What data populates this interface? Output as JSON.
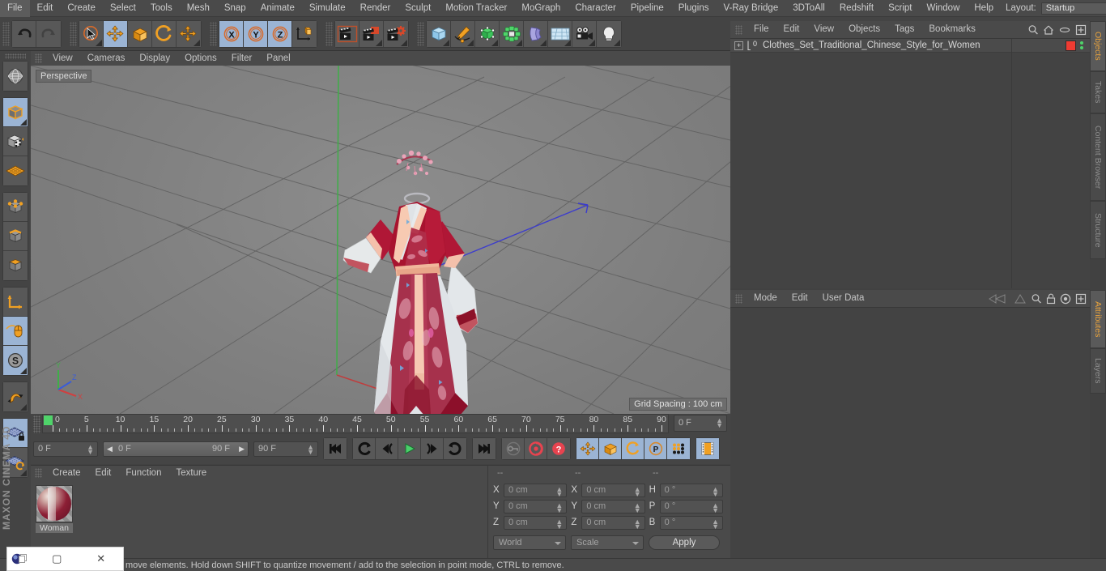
{
  "menubar": {
    "items": [
      "File",
      "Edit",
      "Create",
      "Select",
      "Tools",
      "Mesh",
      "Snap",
      "Animate",
      "Simulate",
      "Render",
      "Sculpt",
      "Motion Tracker",
      "MoGraph",
      "Character",
      "Pipeline",
      "Plugins",
      "V-Ray Bridge",
      "3DToAll",
      "Redshift",
      "Script",
      "Window",
      "Help"
    ],
    "layout_label": "Layout:",
    "layout_value": "Startup"
  },
  "toolbar": {
    "groups": [
      {
        "name": "undo-redo",
        "buttons": [
          {
            "icon": "undo-icon",
            "label": "Undo",
            "active": false
          },
          {
            "icon": "redo-icon",
            "label": "Redo",
            "active": false
          }
        ]
      },
      {
        "name": "transform-tools",
        "buttons": [
          {
            "icon": "live-selection-icon",
            "label": "Live Selection",
            "active": false
          },
          {
            "icon": "move-icon",
            "label": "Move",
            "active": true
          },
          {
            "icon": "scale-icon",
            "label": "Scale",
            "active": false
          },
          {
            "icon": "rotate-icon",
            "label": "Rotate",
            "active": false
          },
          {
            "icon": "move-dup-icon",
            "label": "Move",
            "active": false
          }
        ]
      },
      {
        "name": "axis-locks",
        "buttons": [
          {
            "icon": "x-axis-icon",
            "label": "X",
            "active": true
          },
          {
            "icon": "y-axis-icon",
            "label": "Y",
            "active": true
          },
          {
            "icon": "z-axis-icon",
            "label": "Z",
            "active": true
          },
          {
            "icon": "world-object-axis-icon",
            "label": "World/Object",
            "active": false
          }
        ]
      },
      {
        "name": "render-tools",
        "buttons": [
          {
            "icon": "render-view-icon",
            "label": "Render View",
            "active": false
          },
          {
            "icon": "render-region-icon",
            "label": "Render to Picture Viewer",
            "active": false
          },
          {
            "icon": "render-settings-icon",
            "label": "Edit Render Settings",
            "active": false
          }
        ]
      },
      {
        "name": "create-objects",
        "buttons": [
          {
            "icon": "cube-primitive-icon",
            "label": "Cube",
            "active": false
          },
          {
            "icon": "spline-pen-icon",
            "label": "Pen",
            "active": false
          },
          {
            "icon": "subdivision-surface-icon",
            "label": "Subdivision Surface",
            "active": false
          },
          {
            "icon": "mograph-cloner-icon",
            "label": "Cloner",
            "active": false
          },
          {
            "icon": "bend-deformer-icon",
            "label": "Bend",
            "active": false
          },
          {
            "icon": "floor-environment-icon",
            "label": "Floor",
            "active": false
          },
          {
            "icon": "camera-icon",
            "label": "Camera",
            "active": false
          },
          {
            "icon": "light-icon",
            "label": "Light",
            "active": false
          }
        ]
      }
    ]
  },
  "leftbar": {
    "groups": [
      {
        "name": "grp-a",
        "buttons": [
          {
            "icon": "texture-axis-icon",
            "label": "Texture Axis",
            "active": false
          }
        ]
      },
      {
        "name": "grp-modes",
        "buttons": [
          {
            "icon": "model-mode-icon",
            "label": "Model Mode",
            "active": true
          },
          {
            "icon": "texture-mode-icon",
            "label": "Texture Mode",
            "active": false
          },
          {
            "icon": "workplane-mode-icon",
            "label": "Workplane",
            "active": false
          }
        ]
      },
      {
        "name": "grp-components",
        "buttons": [
          {
            "icon": "point-mode-icon",
            "label": "Points",
            "active": false
          },
          {
            "icon": "edge-mode-icon",
            "label": "Edges",
            "active": false
          },
          {
            "icon": "polygon-mode-icon",
            "label": "Polygons",
            "active": false
          }
        ]
      },
      {
        "name": "grp-axis",
        "buttons": [
          {
            "icon": "enable-axis-icon",
            "label": "Enable Axis",
            "active": false
          },
          {
            "icon": "viewport-solo-icon",
            "label": "Viewport Solo",
            "active": true
          },
          {
            "icon": "soft-selection-icon",
            "label": "Soft Selection",
            "active": true
          }
        ]
      },
      {
        "name": "grp-snap",
        "buttons": [
          {
            "icon": "snap-magnet-icon",
            "label": "Enable Snap",
            "active": false
          }
        ]
      },
      {
        "name": "grp-workplane",
        "buttons": [
          {
            "icon": "workplane-lock-icon",
            "label": "Lock Workplane",
            "active": true
          },
          {
            "icon": "workplane-toggle-icon",
            "label": "Planar Workplane",
            "active": false
          }
        ]
      }
    ],
    "brand": "MAXON CINEMA 4D"
  },
  "viewport": {
    "menu": [
      "View",
      "Cameras",
      "Display",
      "Options",
      "Filter",
      "Panel"
    ],
    "camera_label": "Perspective",
    "grid_spacing": "Grid Spacing : 100 cm",
    "axis_gizmo": {
      "x": "X",
      "y": "Y",
      "z": "Z"
    }
  },
  "timeline": {
    "tick_labels": [
      "0",
      "5",
      "10",
      "15",
      "20",
      "25",
      "30",
      "35",
      "40",
      "45",
      "50",
      "55",
      "60",
      "65",
      "70",
      "75",
      "80",
      "85",
      "90"
    ],
    "current_frame": "0 F",
    "range_start": "0 F",
    "range_end": "90 F",
    "max_frame": "90 F",
    "preview_frame": "0 F",
    "transport": [
      {
        "icon": "goto-start-icon",
        "label": "Go to Start",
        "active": false
      },
      {
        "icon": "play-backwards-frame-icon",
        "label": "Go to Previous Key",
        "active": false
      },
      {
        "icon": "step-back-icon",
        "label": "Go to Previous Frame",
        "active": false
      },
      {
        "icon": "play-icon",
        "label": "Play Forwards",
        "active": false
      },
      {
        "icon": "step-forward-icon",
        "label": "Go to Next Frame",
        "active": false
      },
      {
        "icon": "next-key-icon",
        "label": "Go to Next Key",
        "active": false
      },
      {
        "icon": "goto-end-icon",
        "label": "Go to End",
        "active": false
      }
    ],
    "record": [
      {
        "icon": "autokey-key-icon",
        "label": "Record Active Objects",
        "active": false
      },
      {
        "icon": "autokeying-icon",
        "label": "Autokeying",
        "active": false
      },
      {
        "icon": "keyframe-selection-icon",
        "label": "Keyframe Selection",
        "active": false
      }
    ],
    "param": [
      {
        "icon": "position-key-icon",
        "label": "Position",
        "active": true
      },
      {
        "icon": "scale-key-icon",
        "label": "Scale",
        "active": true
      },
      {
        "icon": "rotation-key-icon",
        "label": "Rotation",
        "active": true
      },
      {
        "icon": "pla-key-icon",
        "label": "Point Level Animation",
        "active": true
      },
      {
        "icon": "parameter-key-icon",
        "label": "Parameter",
        "active": true
      }
    ],
    "extra": [
      {
        "icon": "timeline-filmstrip-icon",
        "label": "Animation Mode",
        "active": true
      }
    ]
  },
  "material_manager": {
    "menu": [
      "Create",
      "Edit",
      "Function",
      "Texture"
    ],
    "materials": [
      {
        "name": "Woman"
      }
    ]
  },
  "coordinates": {
    "headers": [
      "--",
      "--",
      "--"
    ],
    "rows": [
      {
        "label_pos": "X",
        "pos": "0 cm",
        "label_size": "X",
        "size": "0 cm",
        "label_rot": "H",
        "rot": "0 °"
      },
      {
        "label_pos": "Y",
        "pos": "0 cm",
        "label_size": "Y",
        "size": "0 cm",
        "label_rot": "P",
        "rot": "0 °"
      },
      {
        "label_pos": "Z",
        "pos": "0 cm",
        "label_size": "Z",
        "size": "0 cm",
        "label_rot": "B",
        "rot": "0 °"
      }
    ],
    "system": "World",
    "mode": "Scale",
    "apply": "Apply"
  },
  "object_manager": {
    "menu": [
      "File",
      "Edit",
      "View",
      "Objects",
      "Tags",
      "Bookmarks"
    ],
    "header_icons": [
      "search-icon",
      "home-icon",
      "eye-icon",
      "maximize-icon"
    ],
    "rows": [
      {
        "name": "Clothes_Set_Traditional_Chinese_Style_for_Women",
        "layer_badge": "0",
        "material_color": "#ef3b32"
      }
    ]
  },
  "attributes": {
    "menu": [
      "Mode",
      "Edit",
      "User Data"
    ],
    "header_icons": [
      "back-nav-icon",
      "up-nav-icon",
      "search-icon",
      "lock-icon",
      "target-icon",
      "maximize-icon"
    ]
  },
  "vtabs_top": [
    {
      "label": "Objects",
      "selected": true
    },
    {
      "label": "Takes",
      "selected": false
    },
    {
      "label": "Content Browser",
      "selected": false
    },
    {
      "label": "Structure",
      "selected": false
    }
  ],
  "vtabs_bottom": [
    {
      "label": "Attributes",
      "selected": true
    },
    {
      "label": "Layers",
      "selected": false
    }
  ],
  "statusbar": {
    "text": "move elements. Hold down SHIFT to quantize movement / add to the selection in point mode, CTRL to remove."
  },
  "overlay_window": {
    "icon": "app-sphere-icon",
    "maximize": "▢",
    "close": "✕"
  },
  "colors": {
    "panel_bg": "#454545",
    "accent_blue": "#9bb4d4",
    "accent_orange": "#e8a33d",
    "green_marker": "#4fd46a",
    "material_red": "#ef3b32"
  }
}
